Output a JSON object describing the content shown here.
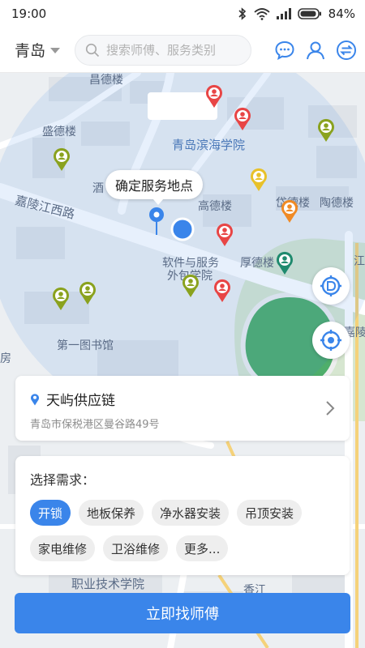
{
  "status_bar": {
    "time": "19:00",
    "battery": "84%"
  },
  "top_bar": {
    "city": "青岛",
    "search_placeholder": "搜索师傅、服务类别",
    "icons": [
      "chat-icon",
      "user-icon",
      "switch-icon"
    ]
  },
  "map": {
    "callout": "确定服务地点",
    "labels": {
      "changdelou": "昌德楼",
      "shengdelou": "盛德楼",
      "binhai": "青岛滨海学院",
      "jialingjiang": "嘉陵江西路",
      "jiu": "酒",
      "gaodelou": "高德楼",
      "daidelou": "岱德楼",
      "taodelou": "陶德楼",
      "ruanjian1": "软件与服务",
      "ruanjian2": "外包学院",
      "houdelou": "厚德楼",
      "diyi": "第一图书馆",
      "fang": "房",
      "zhiye": "职业技术学院",
      "jiang": "江",
      "jialing2": "嘉陵",
      "xiangjiang": "香江"
    },
    "colors": {
      "accent": "#3a85ea",
      "pin_red": "#e84545",
      "pin_green": "#8aa21e",
      "pin_yellow": "#e8c12a",
      "pin_orange": "#f08a24",
      "pin_teal": "#1f8a6e"
    }
  },
  "address": {
    "title": "天屿供应链",
    "detail": "青岛市保税港区曼谷路49号"
  },
  "demand": {
    "title": "选择需求：",
    "tags": [
      "开锁",
      "地板保养",
      "净水器安装",
      "吊顶安装",
      "家电维修",
      "卫浴维修",
      "更多..."
    ],
    "selected": "开锁"
  },
  "action": {
    "label": "立即找师傅"
  }
}
